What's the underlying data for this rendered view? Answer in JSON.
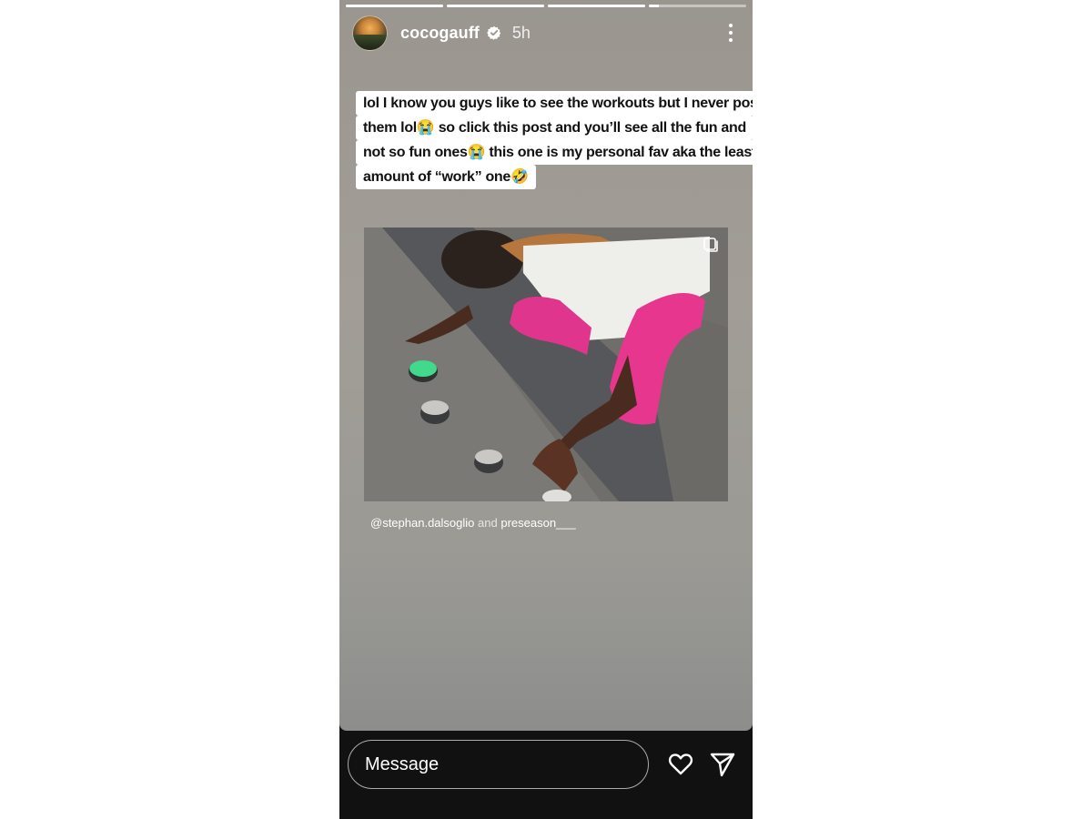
{
  "story": {
    "progress_segments": [
      {
        "fill": 1.0
      },
      {
        "fill": 1.0
      },
      {
        "fill": 1.0
      },
      {
        "fill": 0.1
      }
    ],
    "header": {
      "username": "cocogauff",
      "verified": true,
      "time_ago": "5h",
      "avatar_icon": "profile-avatar",
      "more_icon": "more-vertical-icon"
    },
    "caption_lines": [
      "lol I know you guys like to see the workouts but I never post",
      "them lol😭 so click this post and you’ll see all the fun and",
      "not so fun ones😭 this one is my personal fav aka the least",
      "amount of “work” one🤣"
    ],
    "embedded_post": {
      "multi_post_icon": "multiple-posts-icon",
      "credit_handle": "@stephan.dalsoglio",
      "credit_and": "and",
      "credit_second": "preseason___"
    }
  },
  "reply_bar": {
    "placeholder": "Message",
    "like_icon": "heart-icon",
    "share_icon": "send-icon"
  },
  "colors": {
    "background_top": "#9a968f",
    "bottom_bar": "#111111",
    "caption_bg": "#ffffff"
  }
}
